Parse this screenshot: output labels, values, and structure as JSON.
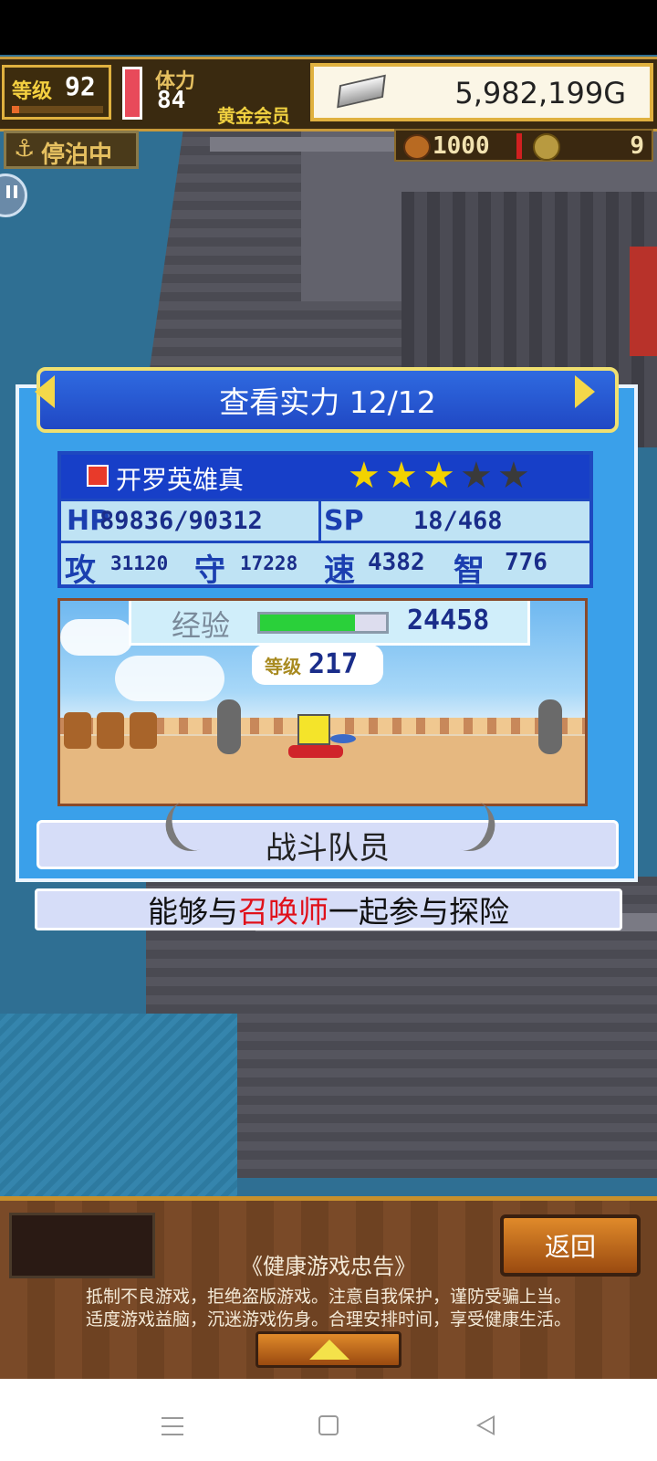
{
  "hud": {
    "level_label": "等级",
    "level_value": "92",
    "stamina_label": "体力",
    "stamina_value": "84",
    "membership": "黄金会员",
    "gold": "5,982,199G",
    "status": "停泊中",
    "food": "1000",
    "coins": "9"
  },
  "panel": {
    "title": "查看实力 12/12",
    "name": "开罗英雄真",
    "stars_total": 5,
    "stars_filled": 3,
    "hp_label": "HP",
    "hp_value": "89836/90312",
    "sp_label": "SP",
    "sp_value": "18/468",
    "atk_label": "攻",
    "atk_value": "31120",
    "def_label": "守",
    "def_value": "17228",
    "spd_label": "速",
    "spd_value": "4382",
    "int_label": "智",
    "int_value": "776",
    "exp_label": "经验",
    "exp_value": "24458",
    "exp_fill": 0.75,
    "rank_label": "等级",
    "rank_value": "217",
    "crew_label": "战斗队员",
    "desc_before": "能够与",
    "desc_highlight": "召唤师",
    "desc_after": "一起参与探险"
  },
  "bottom": {
    "back_button": "返回",
    "notice_title": "《健康游戏忠告》",
    "notice_line1": "抵制不良游戏，拒绝盗版游戏。注意自我保护，谨防受骗上当。",
    "notice_line2": "适度游戏益脑，沉迷游戏伤身。合理安排时间，享受健康生活。"
  },
  "colors": {
    "gold_border": "#e0b13f",
    "panel_blue": "#3aa0ea",
    "title_blue": "#2048c4",
    "star_gold": "#f2d200",
    "hp_red": "#e84a5a",
    "highlight_red": "#e0101a"
  },
  "icons": {
    "anchor": "anchor-icon",
    "silver": "silver-bar-icon",
    "coin": "coin-icon",
    "food": "bread-icon",
    "up": "up-arrow-icon",
    "menu": "menu-icon",
    "home": "home-icon",
    "back": "back-icon"
  }
}
